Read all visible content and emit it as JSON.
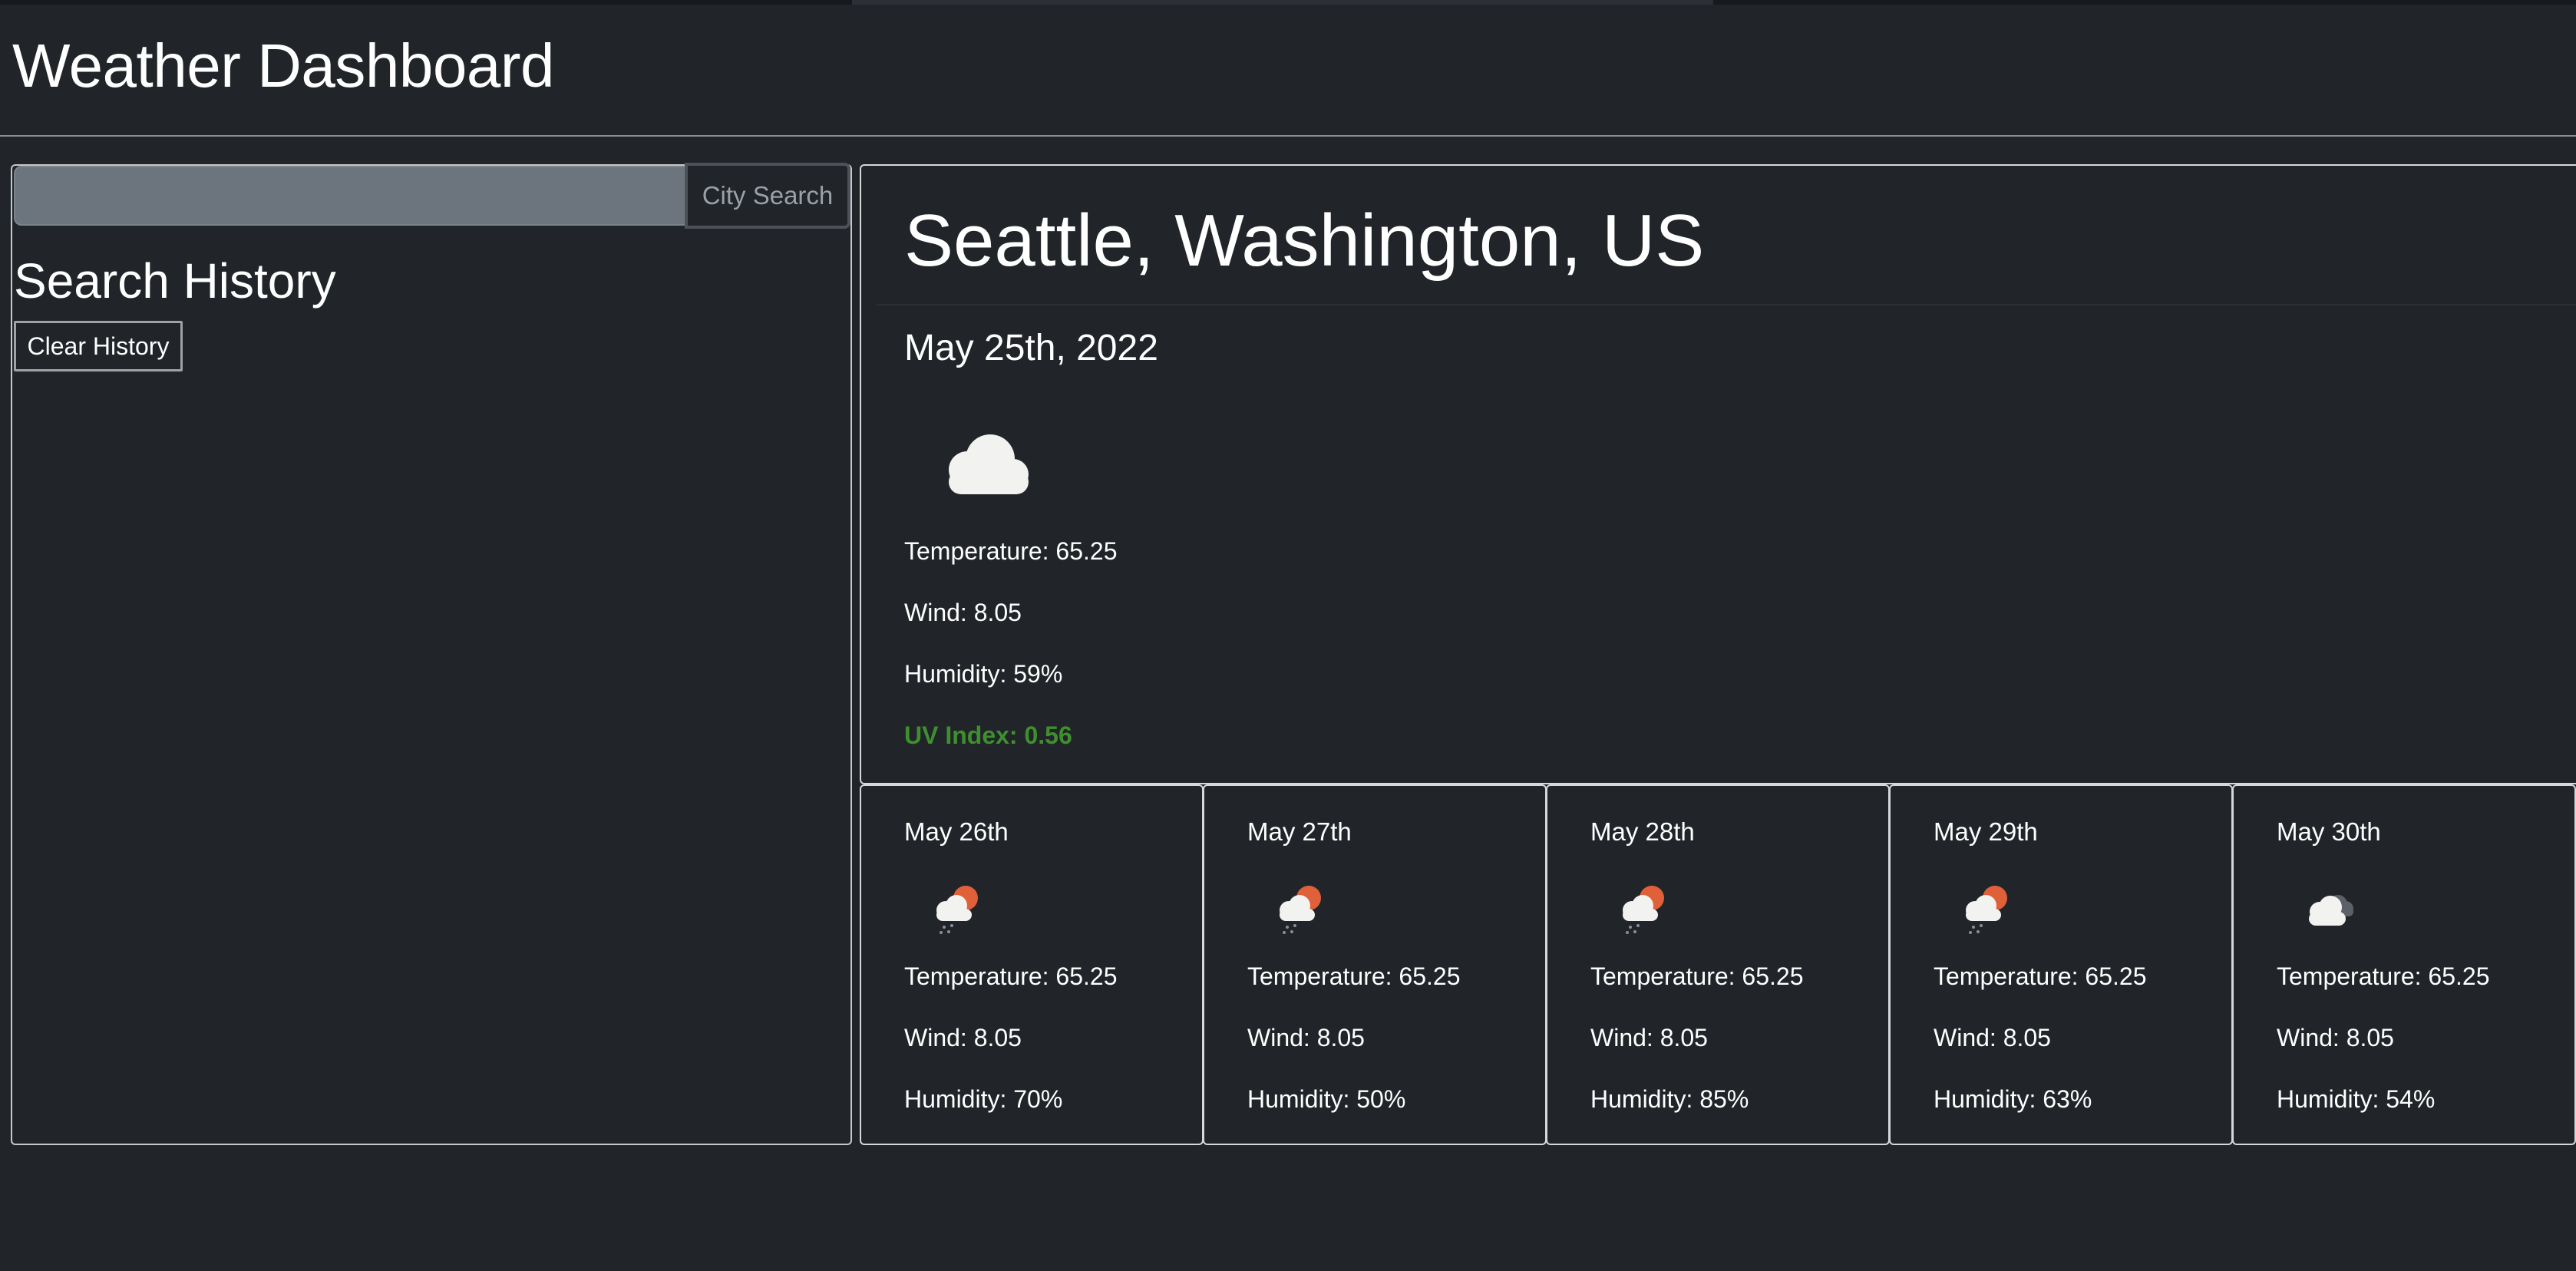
{
  "app": {
    "title": "Weather Dashboard"
  },
  "search": {
    "value": "",
    "placeholder": "",
    "button_label": "City Search"
  },
  "history": {
    "title": "Search History",
    "clear_label": "Clear History"
  },
  "current": {
    "city": "Seattle, Washington, US",
    "date": "May 25th, 2022",
    "icon": "cloud-icon",
    "temperature": "Temperature: 65.25",
    "wind": "Wind: 8.05",
    "humidity": "Humidity: 59%",
    "uv": "UV Index: 0.56",
    "uv_color": "#3f8f2f"
  },
  "forecast": [
    {
      "date": "May 26th",
      "icon": "sun-cloud-rain-icon",
      "temperature": "Temperature: 65.25",
      "wind": "Wind: 8.05",
      "humidity": "Humidity: 70%"
    },
    {
      "date": "May 27th",
      "icon": "sun-cloud-rain-icon",
      "temperature": "Temperature: 65.25",
      "wind": "Wind: 8.05",
      "humidity": "Humidity: 50%"
    },
    {
      "date": "May 28th",
      "icon": "sun-cloud-rain-icon",
      "temperature": "Temperature: 65.25",
      "wind": "Wind: 8.05",
      "humidity": "Humidity: 85%"
    },
    {
      "date": "May 29th",
      "icon": "sun-cloud-rain-icon",
      "temperature": "Temperature: 65.25",
      "wind": "Wind: 8.05",
      "humidity": "Humidity: 63%"
    },
    {
      "date": "May 30th",
      "icon": "broken-clouds-icon",
      "temperature": "Temperature: 65.25",
      "wind": "Wind: 8.05",
      "humidity": "Humidity: 54%"
    }
  ],
  "colors": {
    "background": "#212529",
    "border": "#d6d8da",
    "input_bg": "#6c757d",
    "sun": "#e0603a"
  }
}
